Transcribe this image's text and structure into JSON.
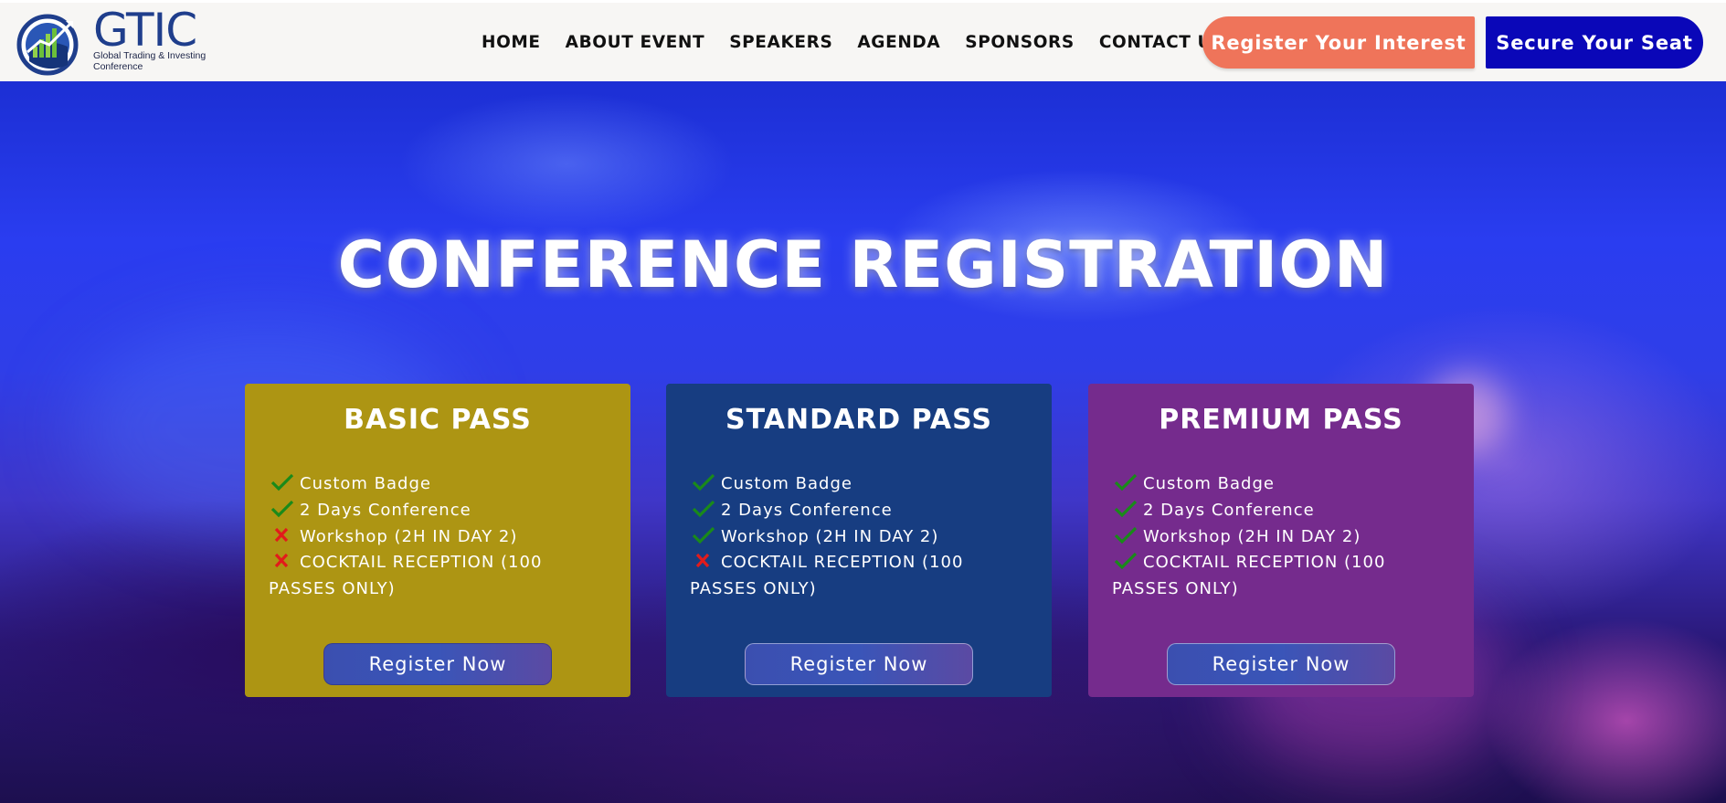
{
  "header": {
    "logo": {
      "title": "GTIC",
      "subtitle_line1": "Global Trading & Investing",
      "subtitle_line2": "Conference"
    },
    "nav": [
      {
        "label": "HOME"
      },
      {
        "label": "ABOUT EVENT"
      },
      {
        "label": "SPEAKERS"
      },
      {
        "label": "AGENDA"
      },
      {
        "label": "SPONSORS"
      },
      {
        "label": "CONTACT US"
      }
    ],
    "register_interest_label": "Register Your Interest",
    "secure_seat_label": "Secure Your Seat"
  },
  "hero": {
    "title": "CONFERENCE REGISTRATION"
  },
  "colors": {
    "basic": "#ad9513",
    "standard": "#173d81",
    "premium": "#752b8d",
    "interest_button": "#ef745a",
    "seat_button": "#0a07b8",
    "check": "#1a8a1a",
    "cross": "#e21b1b"
  },
  "passes": [
    {
      "name": "BASIC PASS",
      "features": [
        {
          "text": "Custom Badge",
          "included": true,
          "icon": "check-icon"
        },
        {
          "text": "2 Days Conference",
          "included": true,
          "icon": "check-icon"
        },
        {
          "text": "Workshop (2H IN DAY 2)",
          "included": false,
          "icon": "cross-icon"
        },
        {
          "text": "COCKTAIL RECEPTION (100 PASSES ONLY)",
          "included": false,
          "icon": "cross-icon"
        }
      ],
      "button_label": "Register Now"
    },
    {
      "name": "STANDARD PASS",
      "features": [
        {
          "text": "Custom Badge",
          "included": true,
          "icon": "check-icon"
        },
        {
          "text": "2 Days Conference",
          "included": true,
          "icon": "check-icon"
        },
        {
          "text": "Workshop (2H IN DAY 2)",
          "included": true,
          "icon": "check-icon"
        },
        {
          "text": "COCKTAIL RECEPTION (100 PASSES ONLY)",
          "included": false,
          "icon": "cross-icon"
        }
      ],
      "button_label": "Register Now"
    },
    {
      "name": "PREMIUM PASS",
      "features": [
        {
          "text": "Custom Badge",
          "included": true,
          "icon": "check-icon"
        },
        {
          "text": "2 Days Conference",
          "included": true,
          "icon": "check-icon"
        },
        {
          "text": "Workshop (2H IN DAY 2)",
          "included": true,
          "icon": "check-icon"
        },
        {
          "text": "COCKTAIL RECEPTION (100 PASSES ONLY)",
          "included": true,
          "icon": "check-icon"
        }
      ],
      "button_label": "Register Now"
    }
  ]
}
